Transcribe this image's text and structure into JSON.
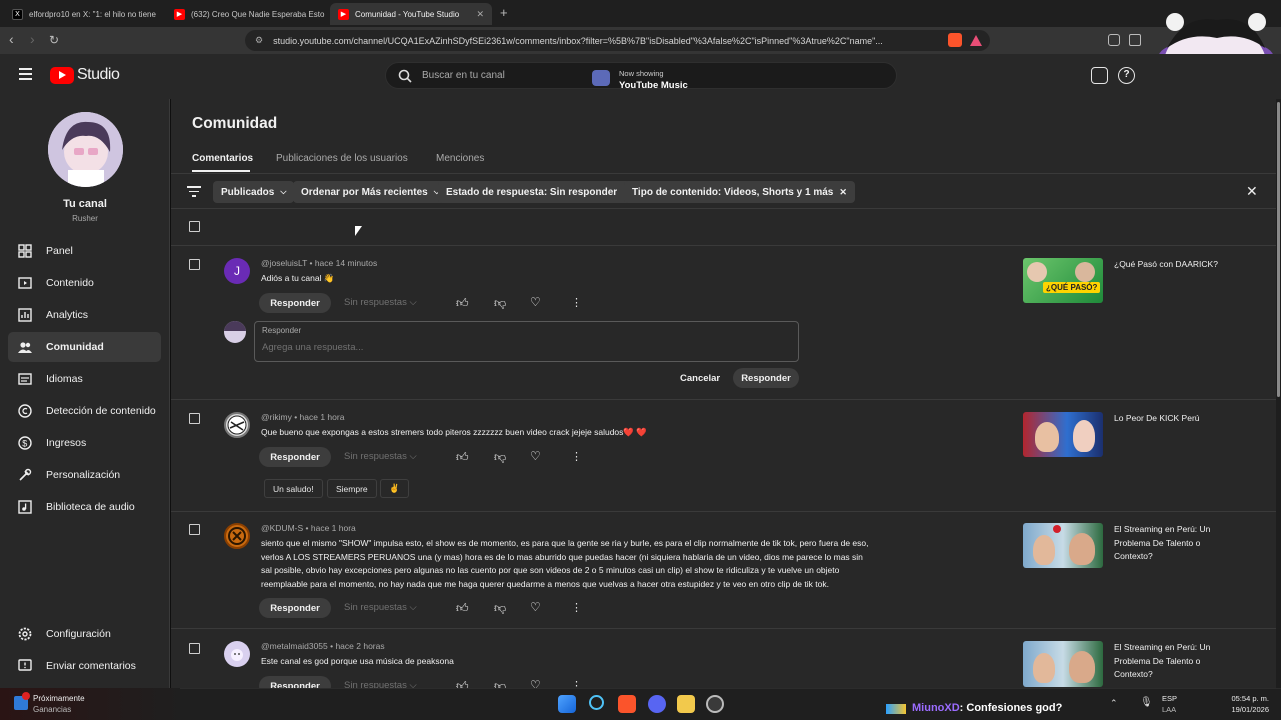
{
  "browser": {
    "tabs": [
      {
        "title": "elfordpro10 en X: \"1: el hilo no tiene"
      },
      {
        "title": "(632) Creo Que Nadie Esperaba Esto"
      },
      {
        "title": "Comunidad - YouTube Studio"
      }
    ],
    "url": "studio.youtube.com/channel/UCQA1ExAZinhSDyfSEi2361w/comments/inbox?filter=%5B%7B\"isDisabled\"%3Afalse%2C\"isPinned\"%3Atrue%2C\"name\"..."
  },
  "header": {
    "logo": "Studio",
    "search_placeholder": "Buscar en tu canal",
    "now_showing_label": "Now showing",
    "now_showing_title": "YouTube Music"
  },
  "sidebar": {
    "channel_title": "Tu canal",
    "channel_name": "Rusher",
    "items": [
      {
        "label": "Panel",
        "icon": "dashboard-icon"
      },
      {
        "label": "Contenido",
        "icon": "content-icon"
      },
      {
        "label": "Analytics",
        "icon": "analytics-icon"
      },
      {
        "label": "Comunidad",
        "icon": "community-icon"
      },
      {
        "label": "Idiomas",
        "icon": "subtitles-icon"
      },
      {
        "label": "Detección de contenido",
        "icon": "copyright-icon"
      },
      {
        "label": "Ingresos",
        "icon": "dollar-icon"
      },
      {
        "label": "Personalización",
        "icon": "customization-icon"
      },
      {
        "label": "Biblioteca de audio",
        "icon": "audio-library-icon"
      }
    ],
    "footer": [
      {
        "label": "Configuración",
        "icon": "gear-icon"
      },
      {
        "label": "Enviar comentarios",
        "icon": "feedback-icon"
      }
    ]
  },
  "page": {
    "title": "Comunidad",
    "tabs": [
      "Comentarios",
      "Publicaciones de los usuarios",
      "Menciones"
    ],
    "filters": [
      "Publicados",
      "Ordenar por Más recientes",
      "Estado de respuesta: Sin responder",
      "Tipo de contenido: Videos, Shorts y 1 más"
    ]
  },
  "comments": [
    {
      "author": "@joseluisLT",
      "time": "hace 14 minutos",
      "text": "Adiós a tu canal 👋",
      "avatar_letter": "J",
      "video": "¿Qué Pasó con DAARICK?"
    },
    {
      "author": "@rikimy",
      "time": "hace 1 hora",
      "text": "Que bueno que expongas a estos stremers todo piteros zzzzzzz buen video crack jejeje saludos❤️ ❤️",
      "video": "Lo Peor De KICK Perú",
      "quick_replies": [
        "Un saludo!",
        "Siempre",
        "✌️"
      ]
    },
    {
      "author": "@KDUM-S",
      "time": "hace 1 hora",
      "text": "siento que el mismo \"SHOW\" impulsa esto, el show es de momento, es para que la gente se ria y burle, es para el clip normalmente de tik tok, pero fuera de eso,  verlos A LOS STREAMERS PERUANOS una (y mas) hora es de lo mas aburrido que puedas hacer (ni siquiera hablaria de un video, dios me parece lo mas sin sal posible, obvio hay excepciones pero algunas no las cuento por que son videos de 2 o 5 minutos casi un clip) el show te ridiculiza y te vuelve un objeto reemplaable para el momento, no hay nada que me haga querer quedarme a menos que vuelvas a hacer otra estupidez y te veo en otro clip de tik tok.",
      "video": "El Streaming en Perú: Un Problema De Talento o Contexto?"
    },
    {
      "author": "@metalmaid3055",
      "time": "hace 2 horas",
      "text": "Este canal es god porque usa música de peaksona",
      "video": "El Streaming en Perú: Un Problema De Talento o Contexto?"
    }
  ],
  "actions": {
    "reply": "Responder",
    "no_replies": "Sin respuestas",
    "reply_box_label": "Responder",
    "reply_box_placeholder": "Agrega una respuesta...",
    "cancel": "Cancelar"
  },
  "taskbar": {
    "weather_title": "Próximamente",
    "weather_sub": "Ganancias",
    "now_playing": "MiunoXD",
    "now_playing_song": ": Confesiones god?",
    "lang": "ESP",
    "lang_sub": "LAA",
    "time": "05:54 p. m.",
    "date": "19/01/2026"
  },
  "colors": {
    "brand_red": "#ff0000",
    "background": "#282828",
    "accent_text": "#f1f1f1"
  }
}
